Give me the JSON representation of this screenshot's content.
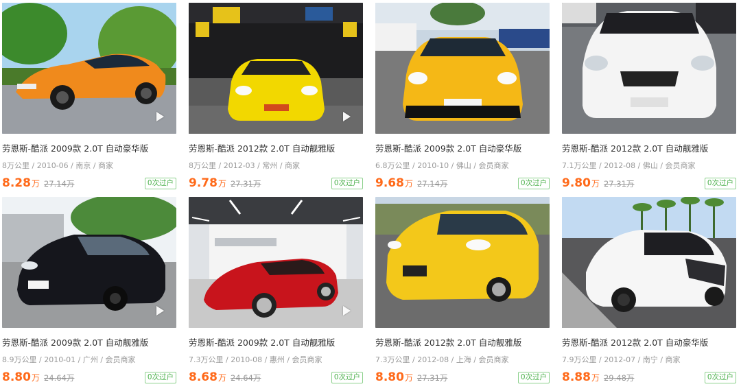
{
  "listings": [
    {
      "title": "劳恩斯-酷派 2009款 2.0T 自动豪华版",
      "meta": "8万公里 / 2010-06 / 南京 / 商家",
      "price": "8.28",
      "price_unit": "万",
      "original_price": "27.14万",
      "badge": "0次过户",
      "car_color": "#f08a1c"
    },
    {
      "title": "劳恩斯-酷派 2012款 2.0T 自动靓雅版",
      "meta": "8万公里 / 2012-03 / 常州 / 商家",
      "price": "9.78",
      "price_unit": "万",
      "original_price": "27.31万",
      "badge": "0次过户",
      "car_color": "#f2d800"
    },
    {
      "title": "劳恩斯-酷派 2009款 2.0T 自动豪华版",
      "meta": "6.8万公里 / 2010-10 / 佛山 / 会员商家",
      "price": "9.68",
      "price_unit": "万",
      "original_price": "27.14万",
      "badge": "0次过户",
      "car_color": "#f5b816"
    },
    {
      "title": "劳恩斯-酷派 2012款 2.0T 自动靓雅版",
      "meta": "7.1万公里 / 2012-08 / 佛山 / 会员商家",
      "price": "9.80",
      "price_unit": "万",
      "original_price": "27.31万",
      "badge": "0次过户",
      "car_color": "#f4f4f4"
    },
    {
      "title": "劳恩斯-酷派 2009款 2.0T 自动靓雅版",
      "meta": "8.9万公里 / 2010-01 / 广州 / 会员商家",
      "price": "8.80",
      "price_unit": "万",
      "original_price": "24.64万",
      "badge": "0次过户",
      "car_color": "#15161c"
    },
    {
      "title": "劳恩斯-酷派 2009款 2.0T 自动靓雅版",
      "meta": "7.3万公里 / 2010-08 / 惠州 / 会员商家",
      "price": "8.68",
      "price_unit": "万",
      "original_price": "24.64万",
      "badge": "0次过户",
      "car_color": "#c8141c"
    },
    {
      "title": "劳恩斯-酷派 2012款 2.0T 自动靓雅版",
      "meta": "7.3万公里 / 2012-08 / 上海 / 会员商家",
      "price": "8.80",
      "price_unit": "万",
      "original_price": "27.31万",
      "badge": "0次过户",
      "car_color": "#f3c81a"
    },
    {
      "title": "劳恩斯-酷派 2012款 2.0T 自动豪华版",
      "meta": "7.9万公里 / 2012-07 / 南宁 / 商家",
      "price": "8.88",
      "price_unit": "万",
      "original_price": "29.48万",
      "badge": "0次过户",
      "car_color": "#f6f6f6"
    }
  ]
}
